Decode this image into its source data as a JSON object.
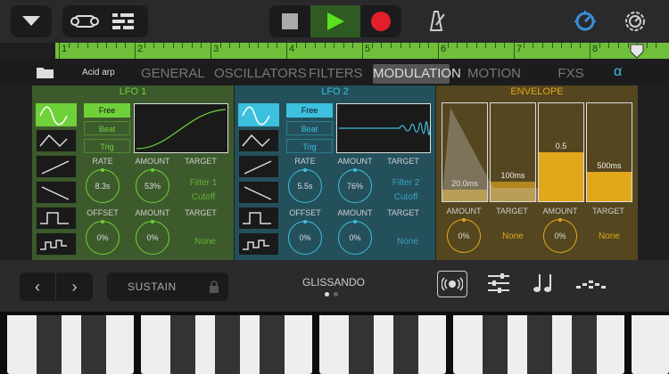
{
  "transport": {
    "icons": [
      "dropdown-icon",
      "track-view-icon",
      "mixer-icon",
      "stop-icon",
      "play-icon",
      "record-icon",
      "metronome-icon",
      "tempo-icon",
      "settings-icon"
    ]
  },
  "ruler": {
    "marks": [
      "1",
      "2",
      "3",
      "4",
      "5",
      "6",
      "7",
      "8"
    ]
  },
  "preset": {
    "name": "Acid arp"
  },
  "tabs": [
    "GENERAL",
    "OSCILLATORS",
    "FILTERS",
    "MODULATION",
    "MOTION",
    "FXS"
  ],
  "active_tab": "MODULATION",
  "lfo1": {
    "title": "LFO 1",
    "sync": [
      "Free",
      "Beat",
      "Trig"
    ],
    "labels": {
      "rate": "RATE",
      "amount": "AMOUNT",
      "target": "TARGET",
      "offset": "OFFSET",
      "amount2": "AMOUNT",
      "target2": "TARGET"
    },
    "rate": "8.3s",
    "amount": "53%",
    "target": "Filter 1 Cutoff",
    "offset": "0%",
    "amount2": "0%",
    "target2": "None",
    "colors": {
      "bg": "#3d5a2c",
      "accent": "#6fd13a"
    }
  },
  "lfo2": {
    "title": "LFO 2",
    "sync": [
      "Free",
      "Beat",
      "Trig"
    ],
    "labels": {
      "rate": "RATE",
      "amount": "AMOUNT",
      "target": "TARGET",
      "offset": "OFFSET",
      "amount2": "AMOUNT",
      "target2": "TARGET"
    },
    "rate": "5.5s",
    "amount": "76%",
    "target": "Filter 2 Cutoff",
    "offset": "0%",
    "amount2": "0%",
    "target2": "None",
    "colors": {
      "bg": "#24505c",
      "accent": "#3cc0de"
    }
  },
  "envelope": {
    "title": "ENVELOPE",
    "stages": {
      "attack": "20.0ms",
      "decay": "100ms",
      "sustain": "0.5",
      "release": "500ms"
    },
    "levels": [
      0.12,
      0.2,
      0.5,
      0.3
    ],
    "labels": [
      "AMOUNT",
      "TARGET",
      "AMOUNT",
      "TARGET"
    ],
    "values": [
      "0%",
      "None",
      "0%",
      "None"
    ],
    "colors": {
      "bg": "#54461f",
      "accent": "#e2a81c"
    }
  },
  "bottom": {
    "sustain": "SUSTAIN",
    "glissando": "GLISSANDO"
  }
}
